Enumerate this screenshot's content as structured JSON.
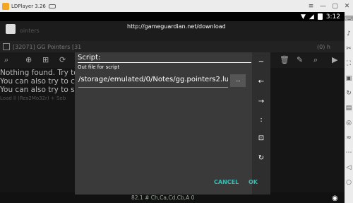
{
  "window": {
    "title": "LDPlayer 3.26"
  },
  "statusbar": {
    "time": "3:12"
  },
  "appbar": {
    "url": "http://gameguardian.net/download",
    "pointers_label": "ointers"
  },
  "process": {
    "info": "[32071] GG Pointers [31",
    "right_text": "(0) h"
  },
  "content": {
    "lines": [
      "Nothing found. Try to s",
      "You can also try to cho",
      "You can also try to sea"
    ],
    "faded": "Load ll (Res2Mo32r) + Seb"
  },
  "bottombar": {
    "text": "82.1 # Ch,Ca,Cd,Cb,A 0"
  },
  "dialog": {
    "title": "Script:",
    "subtitle": "Out file for script",
    "input_value": "/storage/emulated/0/Notes/gg.pointers2.lua",
    "browse_label": "...",
    "cancel_label": "CANCEL",
    "ok_label": "OK",
    "side_icons": [
      "~",
      "←",
      "→",
      ":",
      "⊡",
      "↻"
    ]
  }
}
